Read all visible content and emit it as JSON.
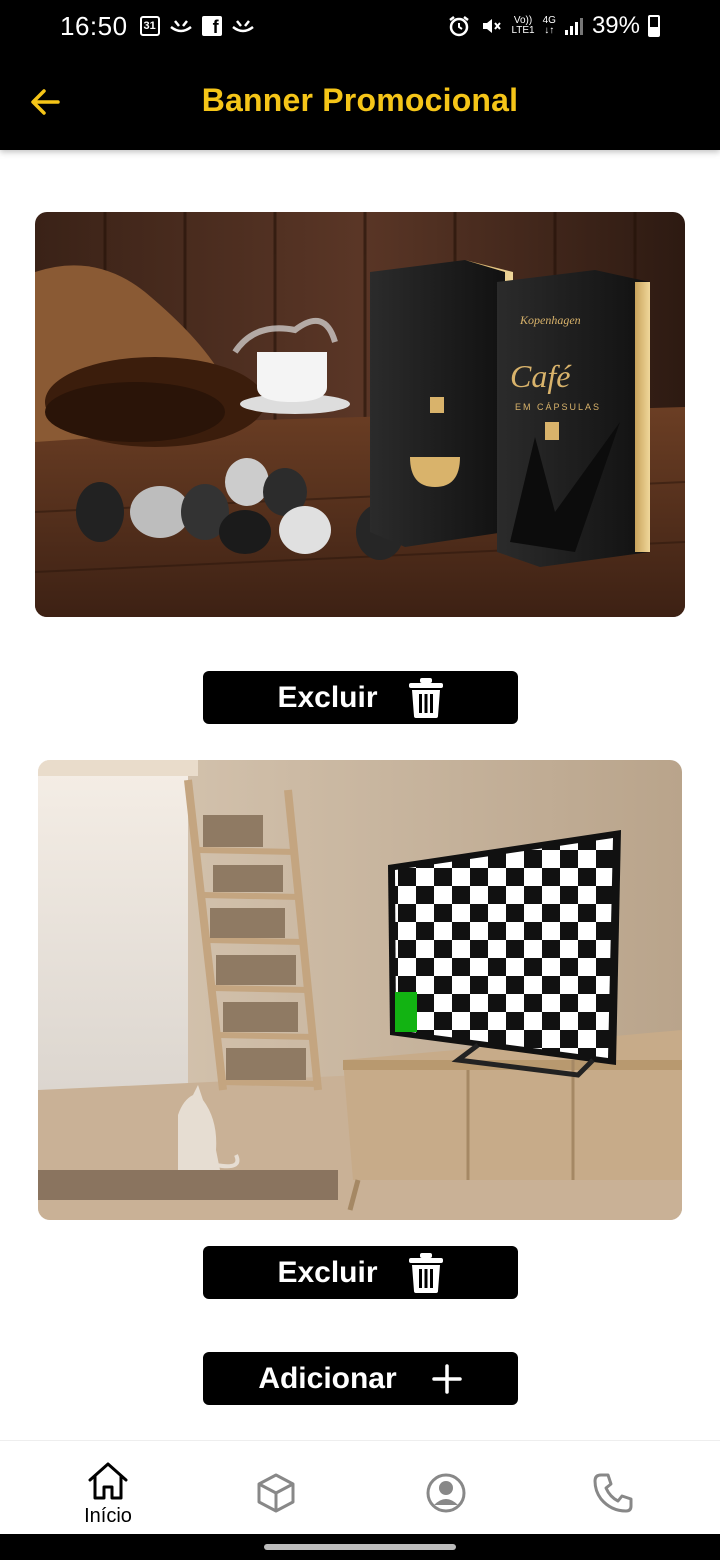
{
  "status_bar": {
    "time": "16:50",
    "calendar_day": "31",
    "network_volte": "Vo))",
    "network_lte": "LTE1",
    "network_4g": "4G",
    "battery": "39%"
  },
  "header": {
    "title": "Banner Promocional",
    "back_icon": "arrow-left-icon"
  },
  "banners": [
    {
      "image": "coffee-capsules-promo",
      "brand_text": "Kopenhagen",
      "product_text": "Café",
      "product_subtext": "EM CÁPSULAS",
      "delete_label": "Excluir",
      "delete_icon": "trash-icon"
    },
    {
      "image": "living-room-tv-placeholder",
      "delete_label": "Excluir",
      "delete_icon": "trash-icon"
    }
  ],
  "add_button": {
    "label": "Adicionar",
    "icon": "plus-icon"
  },
  "bottom_nav": {
    "items": [
      {
        "label": "Início",
        "icon": "home-icon"
      },
      {
        "label": "",
        "icon": "box-icon"
      },
      {
        "label": "",
        "icon": "user-circle-icon"
      },
      {
        "label": "",
        "icon": "phone-icon"
      }
    ]
  },
  "colors": {
    "accent": "#f5c518",
    "bar_background": "#000000",
    "page_background": "#ffffff"
  }
}
